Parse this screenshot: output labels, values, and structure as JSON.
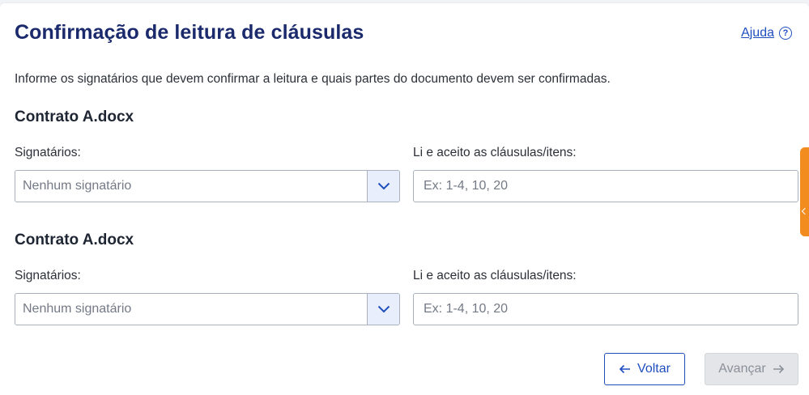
{
  "header": {
    "title": "Confirmação de leitura de cláusulas",
    "help_label": "Ajuda",
    "help_icon_glyph": "?"
  },
  "description": "Informe os signatários que devem confirmar a leitura e quais partes do documento devem ser confirmadas.",
  "sections": [
    {
      "title": "Contrato A.docx",
      "signatories_label": "Signatários:",
      "signatories_value": "Nenhum signatário",
      "clauses_label": "Li e aceito as cláusulas/itens:",
      "clauses_placeholder": "Ex: 1-4, 10, 20",
      "clauses_value": ""
    },
    {
      "title": "Contrato A.docx",
      "signatories_label": "Signatários:",
      "signatories_value": "Nenhum signatário",
      "clauses_label": "Li e aceito as cláusulas/itens:",
      "clauses_placeholder": "Ex: 1-4, 10, 20",
      "clauses_value": ""
    }
  ],
  "footer": {
    "back_label": "Voltar",
    "next_label": "Avançar",
    "next_disabled": true
  },
  "colors": {
    "title": "#1a2a6c",
    "link": "#1f4fbf",
    "side_tab": "#f28c1e",
    "disabled_bg": "#e3e5e8"
  }
}
